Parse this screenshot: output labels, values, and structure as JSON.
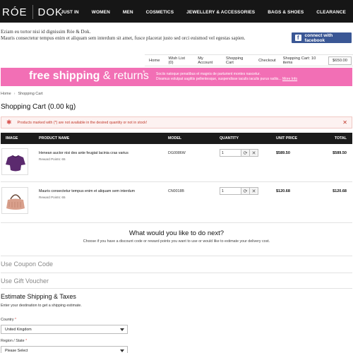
{
  "brand": {
    "left": "RÓE",
    "right": "DOK"
  },
  "nav": [
    "JUST IN",
    "WOMEN",
    "MEN",
    "COSMETICS",
    "JEWELLERY & ACCESSORIES",
    "BAGS & SHOES",
    "CLEARANCE"
  ],
  "intro": {
    "line1": "Eziam eu tortor nisi id dignissim Róe & Dok.",
    "line2": "Mauris consectetur tempus enim et aliquam sem interdum sit amet, fusce placerat justo sed orci euismod vel egestas sapien."
  },
  "facebook": {
    "label": "connect with facebook",
    "icon": "facebook-icon",
    "color": "#3a5795"
  },
  "account_links": [
    "Home",
    "Wish List (0)",
    "My Account",
    "Shopping Cart",
    "Checkout"
  ],
  "cart_summary": {
    "label": "Shopping Cart: 10 items",
    "price": "$650.00"
  },
  "banner": {
    "bold": "free shipping",
    "rest": " & returns",
    "star": "*",
    "line1": "Sociis natoque penatibus et magnis de parturient montes nascetur.",
    "line2": "Divamus volutpat sagittis pellentesque, suspendisse iaculis iaculis purus radiis...",
    "more": "More Info",
    "color": "#f26fb5"
  },
  "breadcrumb": [
    "Home",
    "Shopping Cart"
  ],
  "page_title": "Shopping Cart (0.00 kg)",
  "warning": {
    "text": "Products marked with (*) are not available in the desired quantity or not in stock!",
    "color": "#c0392b"
  },
  "table": {
    "headers": [
      "IMAGE",
      "PRODUCT NAME",
      "MODEL",
      "QUANTITY",
      "UNIT PRICE",
      "TOTAL"
    ],
    "rows": [
      {
        "name": "Henean auctor nisi des ante feugiat lacinia cras varius",
        "reward": "Reward Points: 65",
        "model": "DG0086W",
        "qty": "1",
        "unit": "$589.50",
        "total": "$589.50",
        "image": "purple-top-image"
      },
      {
        "name": "Mauris consectetur tempus enim et aliquam sem interdum",
        "reward": "Reward Points: 65",
        "model": "CN0018B",
        "qty": "1",
        "unit": "$120.68",
        "total": "$120.68",
        "image": "pink-handbag-image"
      }
    ]
  },
  "next": {
    "heading": "What would you like to do next?",
    "text": "Choose if you have a discount code or reward points you want to use or would like to estimate your delivery cost."
  },
  "coupon": "Use Coupon Code",
  "voucher": "Use Gift Voucher",
  "estimate": {
    "heading": "Estimate Shipping & Taxes",
    "text": "Enter your destination to get a shipping estimate.",
    "country_label": "Country",
    "country_value": "United Kingdom",
    "region_label": "Region / State",
    "region_value": "Please Select",
    "required": "*"
  }
}
